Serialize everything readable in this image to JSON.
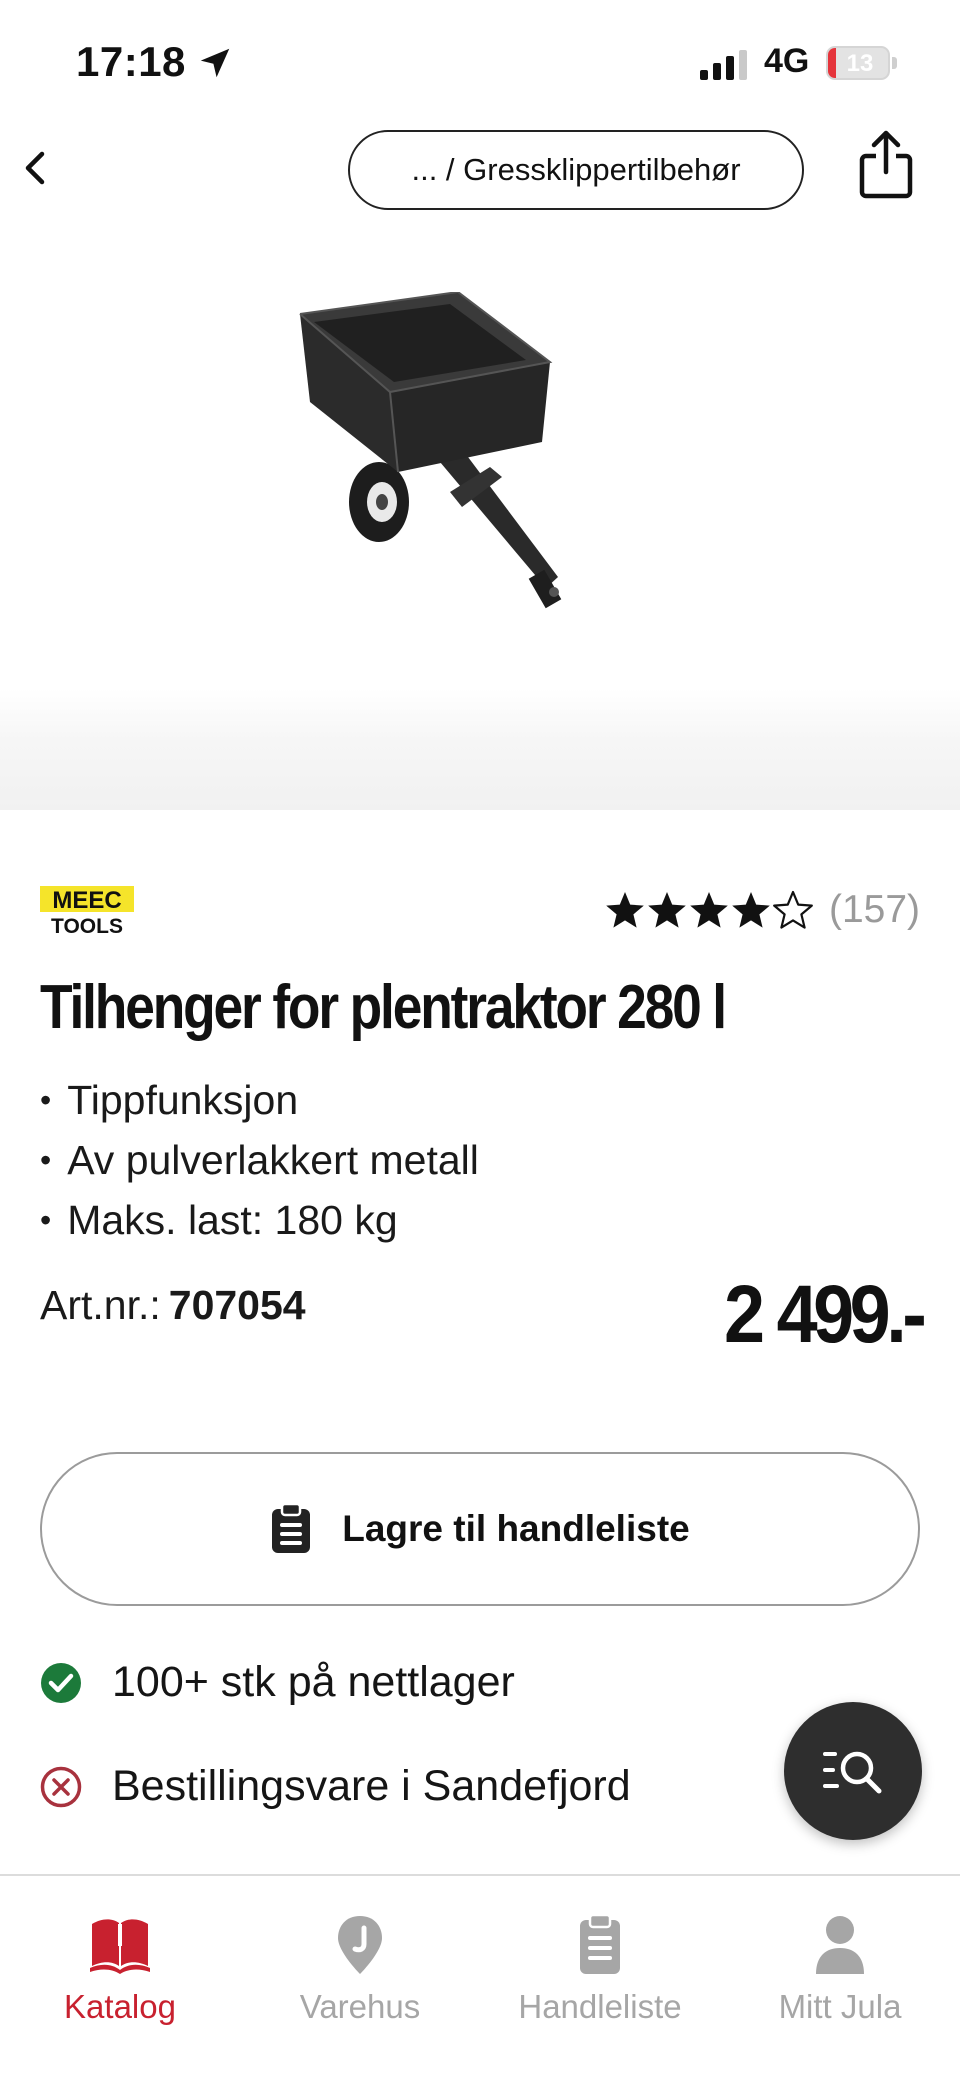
{
  "status_bar": {
    "time": "17:18",
    "network": "4G",
    "battery": "13",
    "battery_level": 0.13
  },
  "header": {
    "breadcrumb": "... / Gressklippertilbehør"
  },
  "product": {
    "brand_line1": "MEEC",
    "brand_line2": "TOOLS",
    "rating_stars": 4,
    "rating_max": 5,
    "rating_count": "(157)",
    "title": "Tilhenger for plentraktor 280 l",
    "features": [
      "Tippfunksjon",
      "Av pulverlakkert metall",
      "Maks. last: 180 kg"
    ],
    "artnr_label": "Art.nr.:",
    "artnr_value": "707054",
    "price": "2 499.-"
  },
  "actions": {
    "save_label": "Lagre til handleliste"
  },
  "stock": {
    "online": "100+ stk på nettlager",
    "store": "Bestillingsvare i Sandefjord"
  },
  "tabs": [
    {
      "label": "Katalog",
      "icon": "book-icon",
      "active": true
    },
    {
      "label": "Varehus",
      "icon": "location-pin-icon",
      "active": false
    },
    {
      "label": "Handleliste",
      "icon": "clipboard-icon",
      "active": false
    },
    {
      "label": "Mitt Jula",
      "icon": "person-icon",
      "active": false
    }
  ],
  "colors": {
    "accent": "#c8212f",
    "in_stock": "#1c7a3a",
    "not_in_stock": "#a8323e",
    "fab": "#2e2e2e",
    "brand_yellow": "#f5e42a"
  }
}
